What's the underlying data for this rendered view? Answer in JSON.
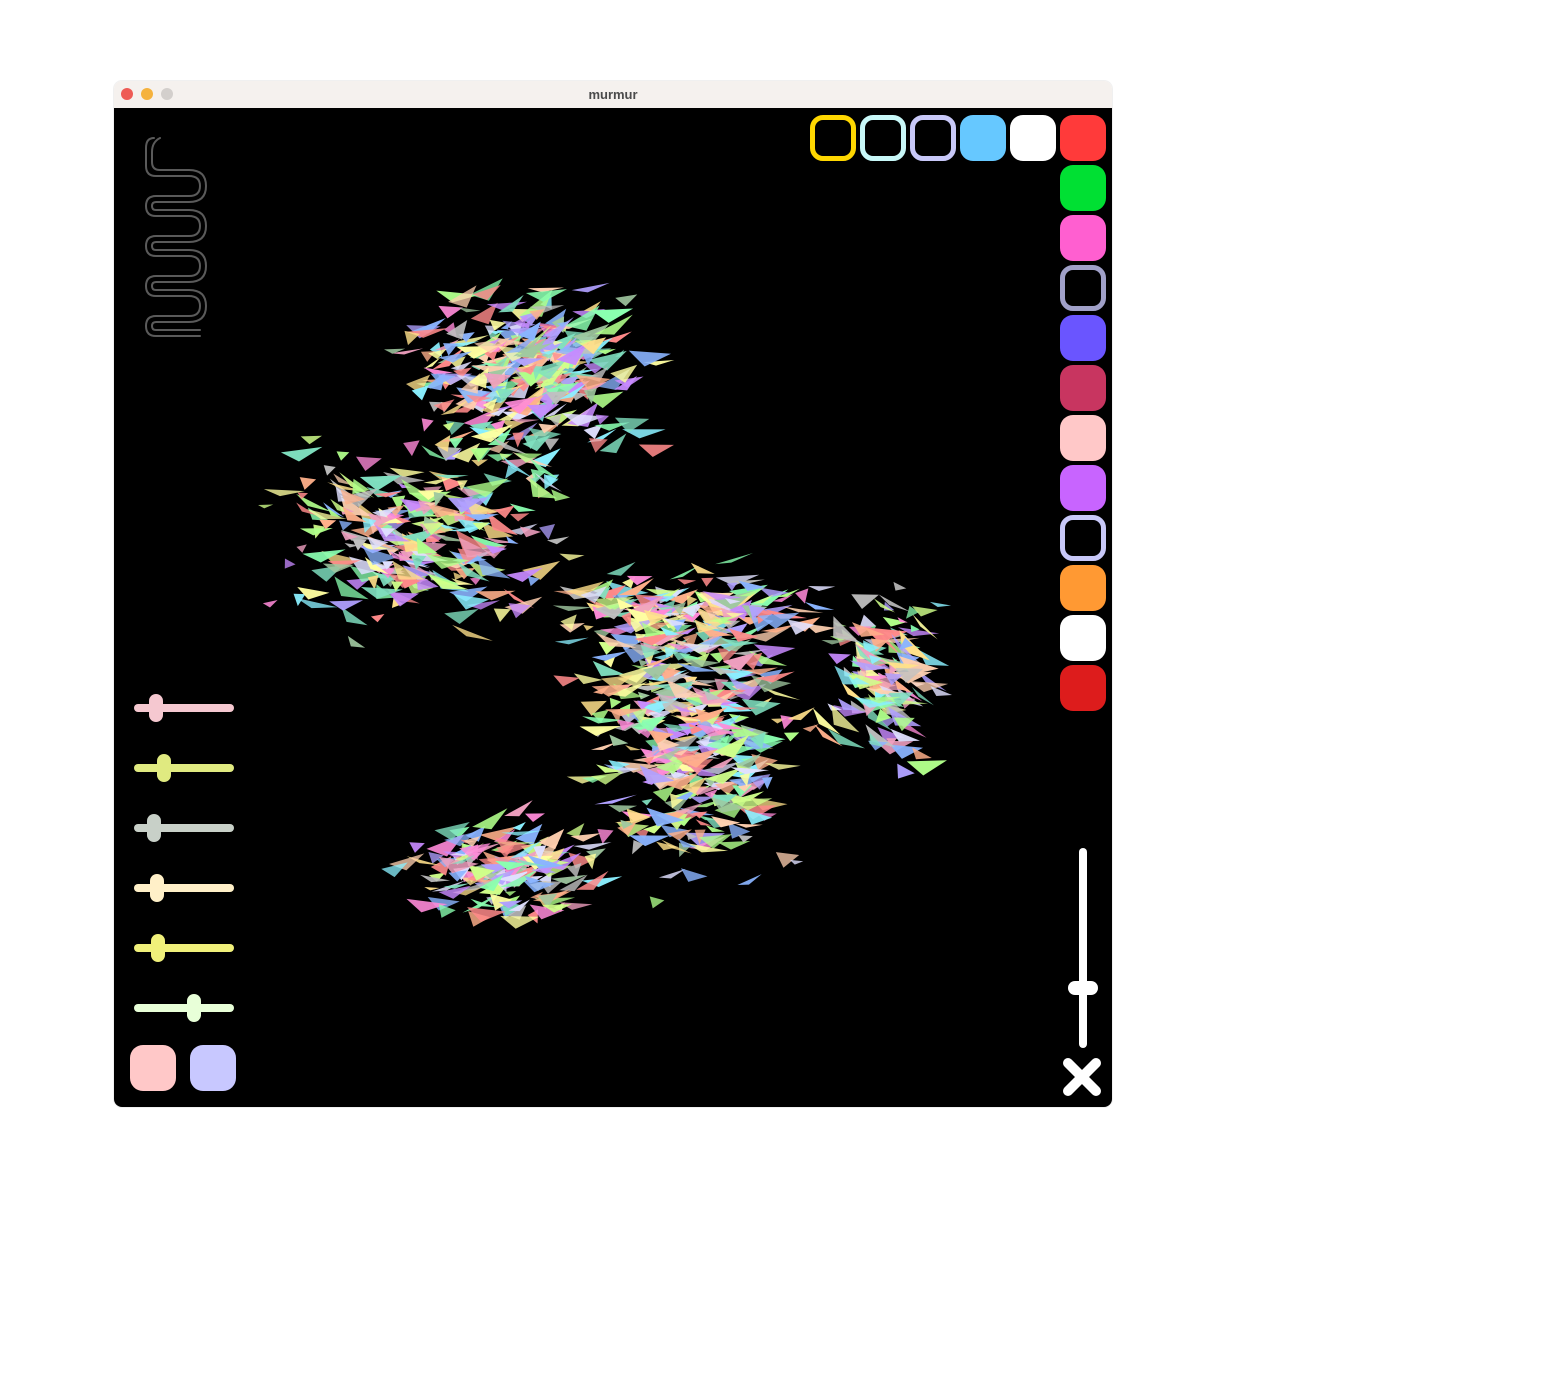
{
  "window": {
    "title": "murmur"
  },
  "logo": {
    "text": "murmur"
  },
  "palette": {
    "top_row": [
      {
        "color": "#ffd700",
        "style": "ring"
      },
      {
        "color": "#c8f8f8",
        "style": "ring"
      },
      {
        "color": "#c8c8f8",
        "style": "ring"
      },
      {
        "color": "#66c8ff",
        "style": "fill"
      },
      {
        "color": "#ffffff",
        "style": "fill"
      },
      {
        "color": "#ff3a3a",
        "style": "fill"
      }
    ],
    "right_column": [
      {
        "color": "#00e033",
        "style": "fill"
      },
      {
        "color": "#ff5fd0",
        "style": "fill"
      },
      {
        "color": "#a0a0c8",
        "style": "ring"
      },
      {
        "color": "#6a55ff",
        "style": "fill"
      },
      {
        "color": "#c83560",
        "style": "fill"
      },
      {
        "color": "#ffc8c8",
        "style": "fill"
      },
      {
        "color": "#c864ff",
        "style": "fill"
      },
      {
        "color": "#c8c8f8",
        "style": "ring"
      },
      {
        "color": "#ff9933",
        "style": "fill"
      },
      {
        "color": "#ffffff",
        "style": "fill"
      },
      {
        "color": "#dd1c1c",
        "style": "fill"
      }
    ]
  },
  "sliders": [
    {
      "color": "#f5c8d0",
      "value": 0.22
    },
    {
      "color": "#e0ea80",
      "value": 0.3
    },
    {
      "color": "#c8d0c8",
      "value": 0.2
    },
    {
      "color": "#fff0c8",
      "value": 0.23
    },
    {
      "color": "#f0f07a",
      "value": 0.24
    },
    {
      "color": "#e8ffd8",
      "value": 0.6
    }
  ],
  "vertical_slider": {
    "color": "#ffffff",
    "value": 0.3
  },
  "bottom_buttons": [
    {
      "color": "#ffc8c8"
    },
    {
      "color": "#c8c8ff"
    }
  ],
  "close_icon": {
    "color": "#ffffff"
  },
  "flock_colors": [
    "#ff8a8a",
    "#8affb0",
    "#8ab4ff",
    "#ffe08a",
    "#c88aff",
    "#8af0ff",
    "#ffb08a",
    "#b0ff8a",
    "#ff8ad8",
    "#e0e0ff",
    "#a0c8a0",
    "#ffd0b0",
    "#d0ff8a",
    "#b0a0ff",
    "#80e0c0",
    "#c0c0c0",
    "#f0a0c0",
    "#ffffa0"
  ]
}
